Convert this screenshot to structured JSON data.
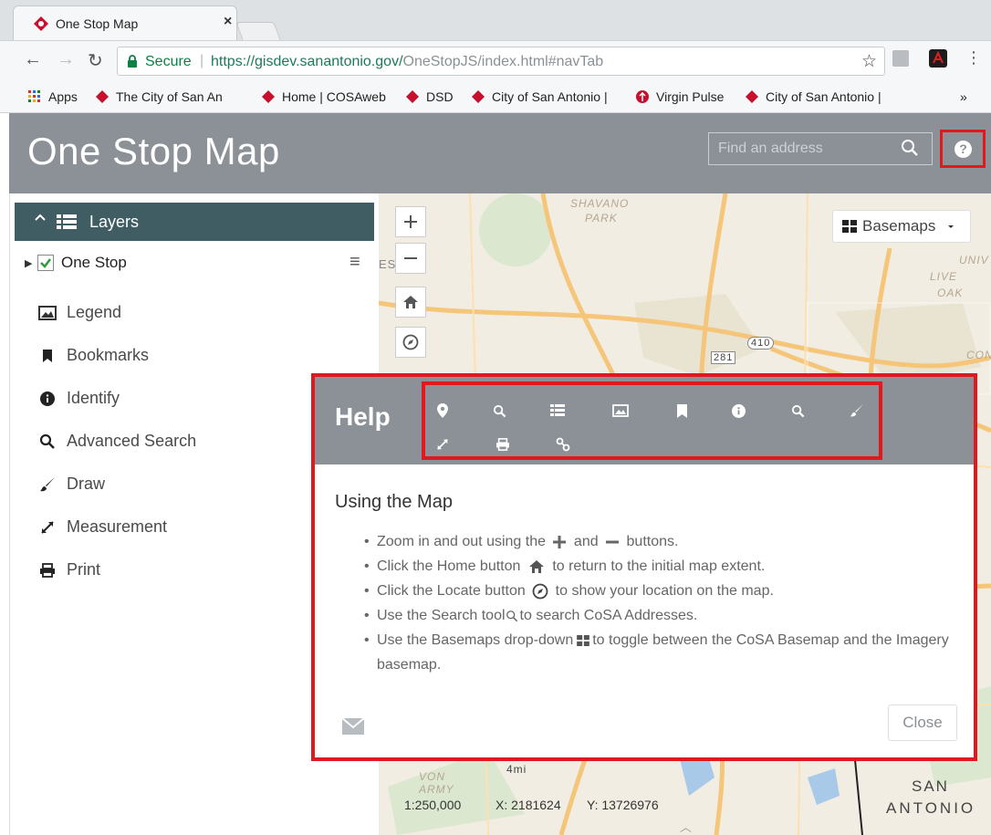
{
  "browser": {
    "tab_title": "One Stop Map",
    "tab_close": "×",
    "secure_label": "Secure",
    "url_host": "https://gisdev.sanantonio.gov/",
    "url_path": "OneStopJS/index.html#navTab",
    "bookmarks": [
      {
        "label": "Apps",
        "icon": "apps-grid-icon"
      },
      {
        "label": "The City of San Anto",
        "icon": "cosa-logo-icon"
      },
      {
        "label": "Home | COSAweb",
        "icon": "cosa-logo-icon"
      },
      {
        "label": "DSD",
        "icon": "cosa-logo-icon"
      },
      {
        "label": "City of San Antonio |",
        "icon": "cosa-logo-icon"
      },
      {
        "label": "Virgin Pulse",
        "icon": "virgin-pulse-icon"
      },
      {
        "label": "City of San Antonio |",
        "icon": "cosa-logo-icon"
      }
    ],
    "bookmarks_overflow": "»"
  },
  "app": {
    "title": "One Stop Map",
    "search_placeholder": "Find an address",
    "help_button": "?"
  },
  "sidebar": {
    "layers_label": "Layers",
    "layer_name": "One Stop",
    "tools": [
      {
        "label": "Legend",
        "icon": "legend-icon"
      },
      {
        "label": "Bookmarks",
        "icon": "bookmark-icon"
      },
      {
        "label": "Identify",
        "icon": "info-icon"
      },
      {
        "label": "Advanced Search",
        "icon": "search-icon"
      },
      {
        "label": "Draw",
        "icon": "brush-icon"
      },
      {
        "label": "Measurement",
        "icon": "measure-icon"
      },
      {
        "label": "Print",
        "icon": "print-icon"
      }
    ]
  },
  "map": {
    "basemaps_label": "Basemaps",
    "scale": "1:250,000",
    "x_coord": "X: 2181624",
    "y_coord": "Y: 13726976",
    "labels": [
      "SHAVANO",
      "PARK",
      "LIVE",
      "OAK",
      "UNIV",
      "CON",
      "VON",
      "ARMY",
      "SAN",
      "ANTONIO",
      "ES",
      "281",
      "410",
      "4mi"
    ]
  },
  "help": {
    "title": "Help",
    "heading": "Using the Map",
    "bullets": {
      "zoom_a": "Zoom in and out using the",
      "zoom_b": "and",
      "zoom_c": "buttons.",
      "home_a": "Click the Home button",
      "home_b": "to return to the initial map extent.",
      "locate_a": "Click the Locate button",
      "locate_b": "to show your location on the map.",
      "search_a": "Use the Search tool",
      "search_b": "to search CoSA Addresses.",
      "basemap_a": "Use the Basemaps drop-down",
      "basemap_b": "to toggle between the CoSA Basemap and the Imagery basemap."
    },
    "close_label": "Close"
  },
  "colors": {
    "header_gray": "#8b9196",
    "layers_bar": "#3f5d62",
    "highlight_red": "#e0191f"
  }
}
